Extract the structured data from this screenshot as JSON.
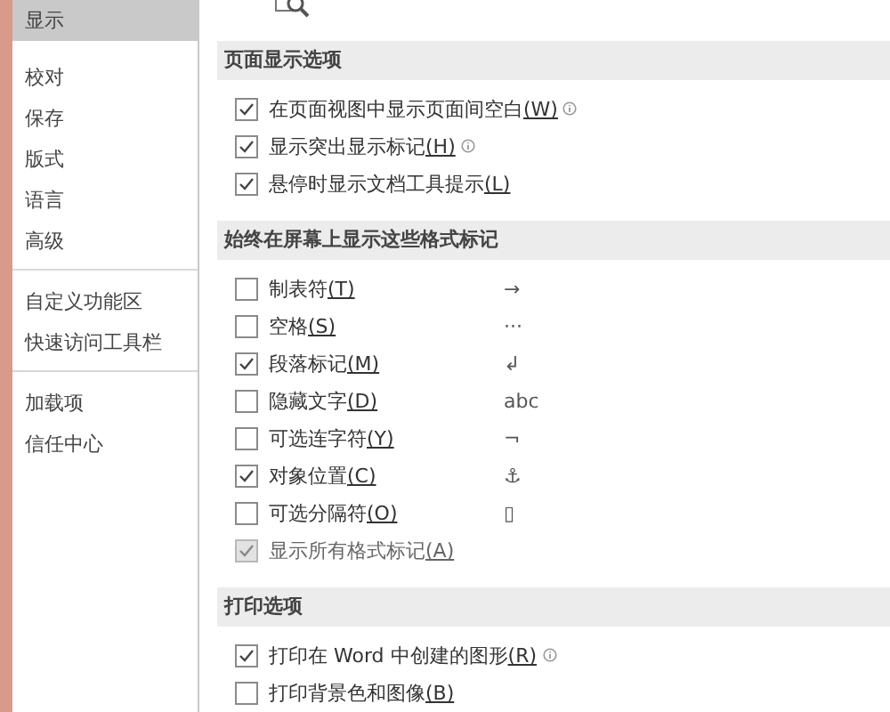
{
  "sidebar": {
    "groups": [
      [
        {
          "label": "显示",
          "selected": true
        },
        {
          "label": "校对",
          "selected": false
        },
        {
          "label": "保存",
          "selected": false
        },
        {
          "label": "版式",
          "selected": false
        },
        {
          "label": "语言",
          "selected": false
        },
        {
          "label": "高级",
          "selected": false
        }
      ],
      [
        {
          "label": "自定义功能区",
          "selected": false
        },
        {
          "label": "快速访问工具栏",
          "selected": false
        }
      ],
      [
        {
          "label": "加载项",
          "selected": false
        },
        {
          "label": "信任中心",
          "selected": false
        }
      ]
    ]
  },
  "sections": [
    {
      "title": "页面显示选项",
      "options": [
        {
          "label": "在页面视图中显示页面间空白",
          "key": "(W)",
          "checked": true,
          "disabled": false,
          "info": true
        },
        {
          "label": "显示突出显示标记",
          "key": "(H)",
          "checked": true,
          "disabled": false,
          "info": true
        },
        {
          "label": "悬停时显示文档工具提示",
          "key": "(L)",
          "checked": true,
          "disabled": false,
          "info": false
        }
      ]
    },
    {
      "title": "始终在屏幕上显示这些格式标记",
      "options": [
        {
          "label": "制表符",
          "key": "(T)",
          "checked": false,
          "disabled": false,
          "info": false,
          "symbol": "→"
        },
        {
          "label": "空格",
          "key": "(S)",
          "checked": false,
          "disabled": false,
          "info": false,
          "symbol": "···"
        },
        {
          "label": "段落标记",
          "key": "(M)",
          "checked": true,
          "disabled": false,
          "info": false,
          "symbol": "↲"
        },
        {
          "label": "隐藏文字",
          "key": "(D)",
          "checked": false,
          "disabled": false,
          "info": false,
          "symbol": "abc"
        },
        {
          "label": "可选连字符",
          "key": "(Y)",
          "checked": false,
          "disabled": false,
          "info": false,
          "symbol": "¬"
        },
        {
          "label": "对象位置",
          "key": "(C)",
          "checked": true,
          "disabled": false,
          "info": false,
          "symbol": "⚓"
        },
        {
          "label": "可选分隔符",
          "key": "(O)",
          "checked": false,
          "disabled": false,
          "info": false,
          "symbol": "▯"
        },
        {
          "label": "显示所有格式标记",
          "key": "(A)",
          "checked": true,
          "disabled": true,
          "info": false
        }
      ]
    },
    {
      "title": "打印选项",
      "options": [
        {
          "label": "打印在 Word 中创建的图形",
          "key": "(R)",
          "checked": true,
          "disabled": false,
          "info": true
        },
        {
          "label": "打印背景色和图像",
          "key": "(B)",
          "checked": false,
          "disabled": false,
          "info": false
        }
      ]
    }
  ]
}
